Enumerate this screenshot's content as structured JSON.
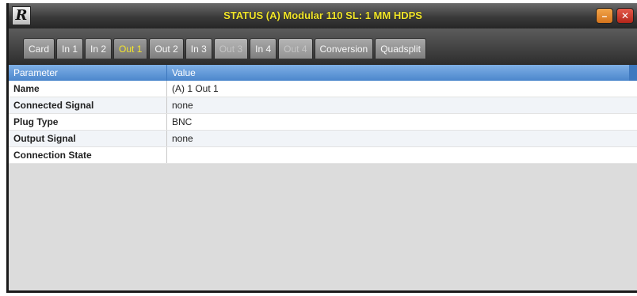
{
  "window": {
    "title": "STATUS (A) Modular 110 SL: 1 MM HDPS",
    "logo_glyph": "R",
    "minimize_glyph": "–",
    "close_glyph": "✕"
  },
  "tabs": [
    {
      "label": "Card",
      "state": "normal"
    },
    {
      "label": "In 1",
      "state": "normal"
    },
    {
      "label": "In 2",
      "state": "normal"
    },
    {
      "label": "Out 1",
      "state": "active"
    },
    {
      "label": "Out 2",
      "state": "normal"
    },
    {
      "label": "In 3",
      "state": "normal"
    },
    {
      "label": "Out 3",
      "state": "disabled"
    },
    {
      "label": "In 4",
      "state": "normal"
    },
    {
      "label": "Out 4",
      "state": "disabled"
    },
    {
      "label": "Conversion",
      "state": "normal"
    },
    {
      "label": "Quadsplit",
      "state": "normal"
    }
  ],
  "table": {
    "headers": {
      "parameter": "Parameter",
      "value": "Value"
    },
    "rows": [
      {
        "parameter": "Name",
        "value": "(A) 1 Out 1"
      },
      {
        "parameter": "Connected Signal",
        "value": "none"
      },
      {
        "parameter": "Plug Type",
        "value": "BNC"
      },
      {
        "parameter": "Output Signal",
        "value": "none"
      },
      {
        "parameter": "Connection State",
        "value": ""
      }
    ]
  },
  "colors": {
    "title_text": "#f2e62a",
    "active_tab_text": "#f3e52b",
    "header_blue": "#4b86cc"
  }
}
